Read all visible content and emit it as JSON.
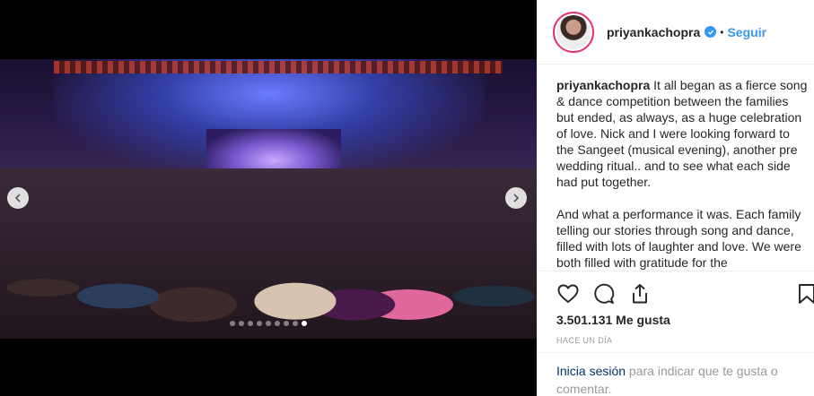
{
  "post": {
    "carousel": {
      "slide_count": 9,
      "active_slide": 8
    }
  },
  "header": {
    "username": "priyankachopra",
    "separator": "•",
    "follow_label": "Seguir"
  },
  "caption": {
    "username": "priyankachopra",
    "paragraph1": "It all began as a fierce song & dance competition between the families but ended, as always, as a huge celebration of love.  Nick and I were looking forward to the Sangeet (musical evening), another pre wedding ritual.. and to see what each side had put together.",
    "paragraph2": "And what a performance it was. Each family telling our stories through song and dance, filled with lots of laughter and love. We were both filled with gratitude for the"
  },
  "actions": {
    "likes": "3.501.131 Me gusta",
    "time_ago": "HACE UN DÍA"
  },
  "login_prompt": {
    "link": "Inicia sesión",
    "text": " para indicar que te gusta o comentar."
  },
  "colors": {
    "accent": "#3897f0",
    "avatar_ring": "#e5336a"
  }
}
